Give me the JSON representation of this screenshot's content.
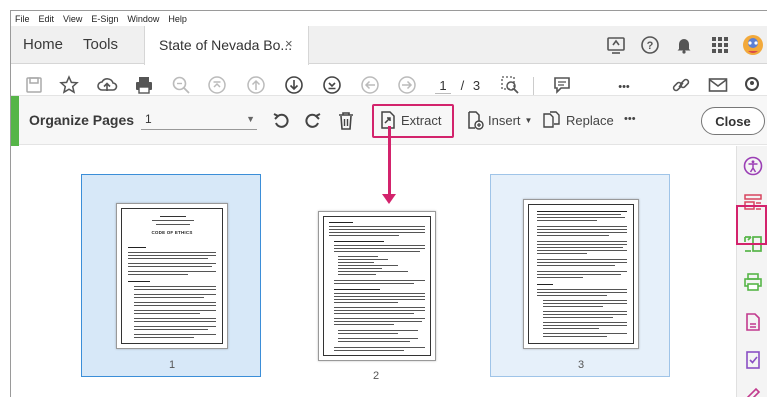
{
  "menu": [
    "File",
    "Edit",
    "View",
    "E-Sign",
    "Window",
    "Help"
  ],
  "tabs": {
    "home": "Home",
    "tools": "Tools",
    "document": "State of Nevada Bo...",
    "close_glyph": "×"
  },
  "toolbar": {
    "current_page": "1",
    "page_separator": "/",
    "total_pages": "3",
    "more": "•••"
  },
  "organize": {
    "title": "Organize Pages",
    "page_select": "1",
    "extract": "Extract",
    "insert": "Insert",
    "replace": "Replace",
    "more": "•••",
    "close": "Close"
  },
  "thumbnails": [
    {
      "number": "1",
      "heading": "CODE OF ETHICS",
      "state": "selected"
    },
    {
      "number": "2",
      "state": "normal"
    },
    {
      "number": "3",
      "state": "highlighted"
    }
  ],
  "icons": {
    "save": "save-icon",
    "bookmark": "star-icon",
    "upload": "cloud-upload-icon",
    "print": "printer-icon",
    "zoom": "zoom-out-icon",
    "accent": "#56b548",
    "highlight": "#d3236c",
    "selection": "#3b8ed8"
  }
}
